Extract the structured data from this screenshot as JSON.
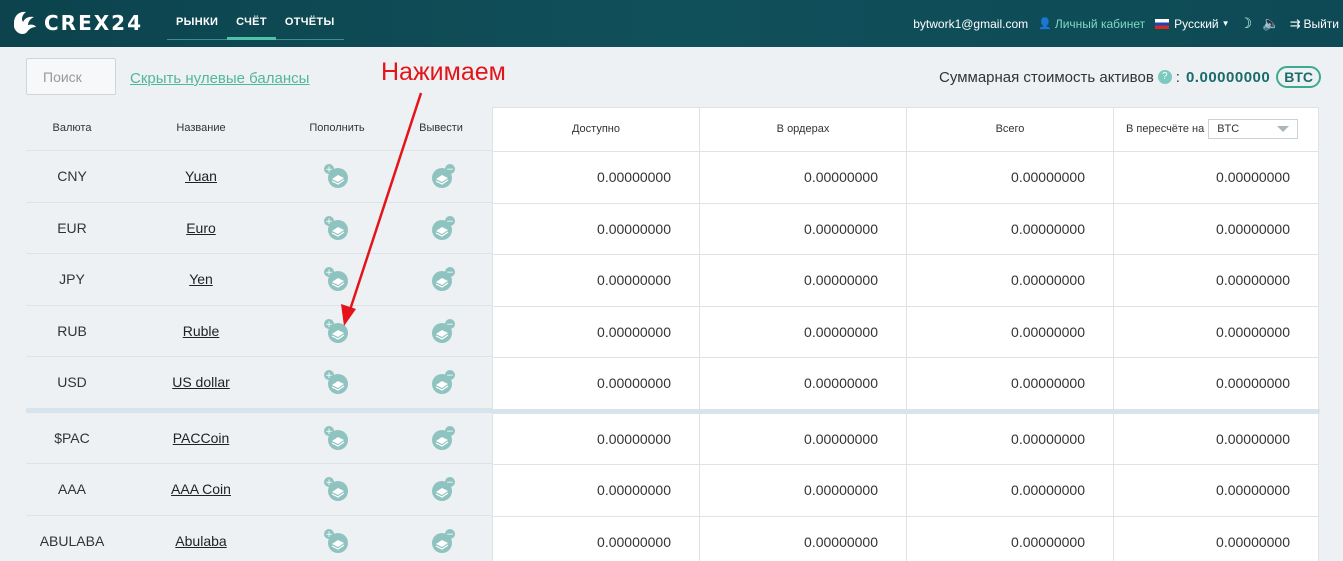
{
  "header": {
    "logo_text": "CREX24",
    "nav": [
      {
        "label": "Рынки",
        "active": false
      },
      {
        "label": "Счёт",
        "active": true
      },
      {
        "label": "Отчёты",
        "active": false
      }
    ],
    "user_email": "bytwork1@gmail.com",
    "cabinet_label": "Личный кабинет",
    "language": "Русский",
    "logout_label": "Выйти"
  },
  "toolbar": {
    "search_placeholder": "Поиск",
    "hide_zero_label": "Скрыть нулевые балансы",
    "total_label": "Суммарная стоимость активов",
    "total_help": "?",
    "total_sep": ":",
    "total_value": "0.00000000",
    "total_currency": "BTC"
  },
  "annotation": "Нажимаем",
  "table": {
    "headers": {
      "currency": "Валюта",
      "name": "Название",
      "deposit": "Пополнить",
      "withdraw": "Вывести",
      "available": "Доступно",
      "in_orders": "В ордерах",
      "total": "Всего",
      "converted": "В пересчёте на",
      "converted_currency": "BTC"
    },
    "fiat_rows": [
      {
        "currency": "CNY",
        "name": "Yuan",
        "available": "0.00000000",
        "in_orders": "0.00000000",
        "total": "0.00000000",
        "converted": "0.00000000"
      },
      {
        "currency": "EUR",
        "name": "Euro",
        "available": "0.00000000",
        "in_orders": "0.00000000",
        "total": "0.00000000",
        "converted": "0.00000000"
      },
      {
        "currency": "JPY",
        "name": "Yen",
        "available": "0.00000000",
        "in_orders": "0.00000000",
        "total": "0.00000000",
        "converted": "0.00000000"
      },
      {
        "currency": "RUB",
        "name": "Ruble",
        "available": "0.00000000",
        "in_orders": "0.00000000",
        "total": "0.00000000",
        "converted": "0.00000000"
      },
      {
        "currency": "USD",
        "name": "US dollar",
        "available": "0.00000000",
        "in_orders": "0.00000000",
        "total": "0.00000000",
        "converted": "0.00000000"
      }
    ],
    "crypto_rows": [
      {
        "currency": "$PAC",
        "name": "PACCoin",
        "available": "0.00000000",
        "in_orders": "0.00000000",
        "total": "0.00000000",
        "converted": "0.00000000"
      },
      {
        "currency": "AAA",
        "name": "AAA Coin",
        "available": "0.00000000",
        "in_orders": "0.00000000",
        "total": "0.00000000",
        "converted": "0.00000000"
      },
      {
        "currency": "ABULABA",
        "name": "Abulaba",
        "available": "0.00000000",
        "in_orders": "0.00000000",
        "total": "0.00000000",
        "converted": "0.00000000"
      }
    ]
  },
  "colors": {
    "header_bg": "#0e4a55",
    "accent": "#4fb896",
    "annotation": "#e4151a"
  }
}
